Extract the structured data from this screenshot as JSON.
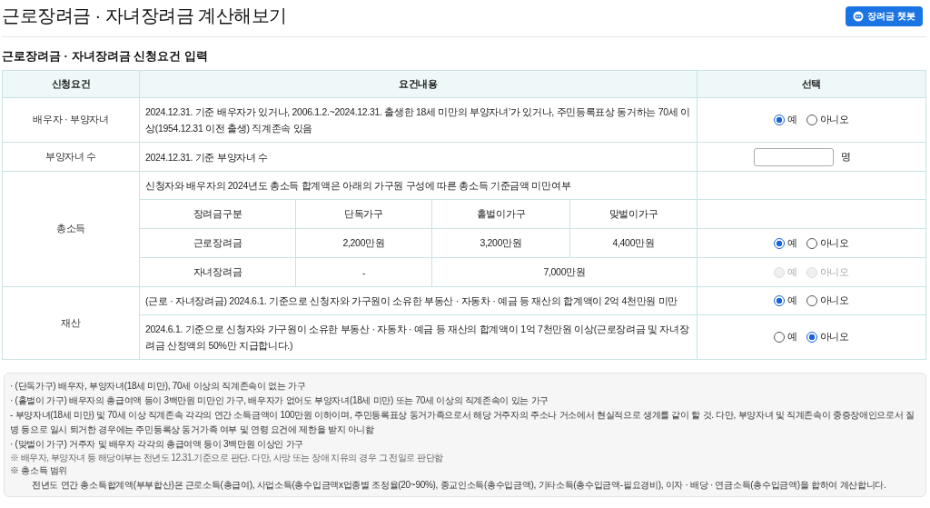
{
  "header": {
    "title": "근로장려금 · 자녀장려금 계산해보기",
    "chatbot_button": "장려금 챗봇"
  },
  "section_title": "근로장려금 · 자녀장려금 신청요건 입력",
  "table": {
    "columns": [
      "신청요건",
      "요건내용",
      "선택"
    ],
    "rows": [
      {
        "kind": "radio",
        "label": "배우자 · 부양자녀",
        "content": "2024.12.31. 기준 배우자가 있거나, 2006.1.2.~2024.12.31. 출생한 18세 미만의 부양자녀’가 있거나, 주민등록표상 동거하는 70세 이상(1954.12.31 이전 출생) 직계존속 있음",
        "options": [
          {
            "label": "예",
            "selected": true
          },
          {
            "label": "아니오",
            "selected": false
          }
        ]
      },
      {
        "kind": "count",
        "label": "부양자녀 수",
        "content": "2024.12.31. 기준 부양자녀 수",
        "unit": "명"
      },
      {
        "kind": "income",
        "label": "총소득",
        "content": "신청자와 배우자의 2024년도 총소득 합계액은 아래의 가구원 구성에 따른 총소득 기준금액 미만여부",
        "columns": [
          "장려금구분",
          "단독가구",
          "홑벌이가구",
          "맞벌이가구"
        ],
        "rows": [
          {
            "cells": [
              "근로장려금",
              "2,200만원",
              "3,200만원",
              "4,400만원"
            ],
            "disabled": false,
            "options": [
              {
                "label": "예",
                "selected": true
              },
              {
                "label": "아니오",
                "selected": false
              }
            ]
          },
          {
            "cells": [
              "자녀장려금",
              "-",
              {
                "text": "7,000만원",
                "colspan": 2
              }
            ],
            "disabled": true,
            "options": [
              {
                "label": "예",
                "selected": false
              },
              {
                "label": "아니오",
                "selected": false
              }
            ]
          }
        ]
      },
      {
        "kind": "multi",
        "label": "재산",
        "items": [
          {
            "content": "(근로 · 자녀장려금) 2024.6.1. 기준으로 신청자와 가구원이 소유한 부동산 · 자동차 · 예금 등 재산의 합계액이 2억 4천만원 미만",
            "options": [
              {
                "label": "예",
                "selected": true
              },
              {
                "label": "아니오",
                "selected": false
              }
            ]
          },
          {
            "content": "2024.6.1. 기준으로 신청자와 가구원이 소유한 부동산 · 자동차 · 예금 등 재산의 합계액이 1억 7천만원 이상(근로장려금 및 자녀장려금 산정액의 50%만 지급합니다.)",
            "options": [
              {
                "label": "예",
                "selected": false
              },
              {
                "label": "아니오",
                "selected": true
              }
            ]
          }
        ]
      }
    ]
  },
  "notes": [
    {
      "kind": "line",
      "text": "· (단독가구) 배우자, 부양자녀(18세 미만), 70세 이상의 직계존속이 없는 가구"
    },
    {
      "kind": "line",
      "text": "· (홑벌이 가구) 배우자의 총급여액 등이 3백만원 미만인 가구, 배우자가 없어도 부양자녀(18세 미만) 또는 70세 이상의 직계존속이 있는 가구"
    },
    {
      "kind": "line",
      "text": "- 부양자녀(18세 미만) 및 70세 이상 직계존속 각각의 연간 소득금액이 100만원 이하이며, 주민등록표상 동거가족으로서 해당 거주자의 주소나 거소에서 현실적으로 생계를 같이 할 것. 다만, 부양자녀 및 직계존속이 중증장애인으로서 질병 등으로 일시 퇴거한 경우에는 주민등록상 동거가족 여부 및 연령 요건에 제한을 받지 아니함"
    },
    {
      "kind": "line",
      "text": "· (맞벌이 가구) 거주자 및 배우자 각각의 총급여액 등이 3백만원 이상인 가구"
    },
    {
      "kind": "small",
      "text": "※ 배우자, 부양자녀 등 해당여부는 전년도 12.31.기준으로 판단. 다만, 사망 또는 장애 치유의 경우 그 전일로 판단함"
    },
    {
      "kind": "line",
      "text": "※ 총소득 범위"
    },
    {
      "kind": "indent",
      "text": "전년도 연간 총소득합계액(부부합산)은 근로소득(총급여), 사업소득(총수입금액x업종별 조정율(20~90%), 종교인소득(총수입금액), 기타소득(총수입금액-필요경비), 이자 · 배당 · 연금소득(총수입금액)을 합하여 계산합니다."
    }
  ]
}
